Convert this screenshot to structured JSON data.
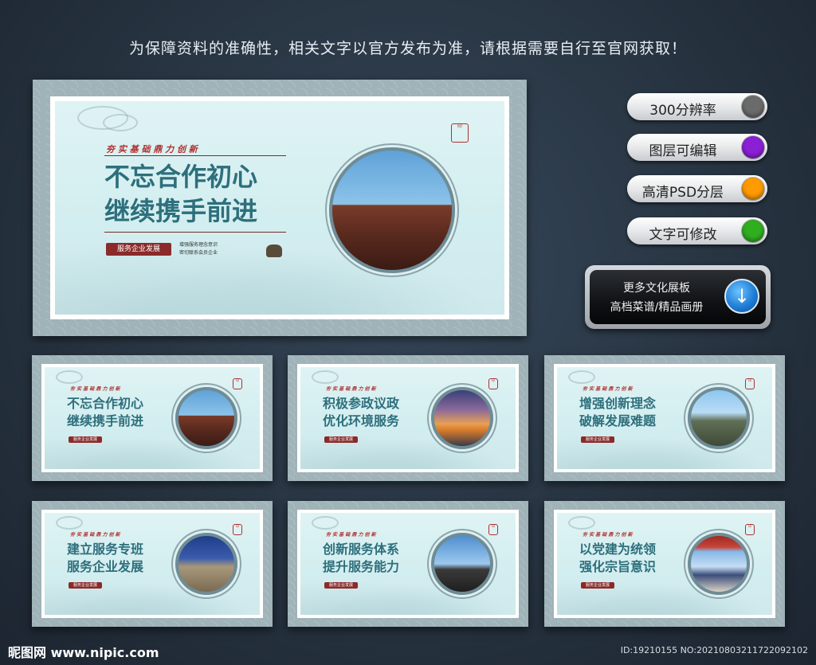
{
  "notice": "为保障资料的准确性，相关文字以官方发布为准，请根据需要自行至官网获取！",
  "main_board": {
    "subtitle": "夯 实 基 础   鼎 力 创 新",
    "title_line1": "不忘合作初心",
    "title_line2": "继续携手前进",
    "tag": "服务企业发展",
    "small_line1": "增强服务理念意识",
    "small_line2": "密切联系会员企业"
  },
  "features": [
    {
      "label": "300分辨率",
      "color": "#6b6b6b"
    },
    {
      "label": "图层可编辑",
      "color": "#8a1fd6"
    },
    {
      "label": "高清PSD分层",
      "color": "#ff9a00"
    },
    {
      "label": "文字可修改",
      "color": "#2fae1f"
    }
  ],
  "more_button": {
    "line1": "更多文化展板",
    "line2": "高档菜谱/精品画册",
    "icon": "download-arrow-icon"
  },
  "thumbnails": [
    {
      "subtitle": "夯 实 基 础   鼎 力 创 新",
      "line1": "不忘合作初心",
      "line2": "继续携手前进",
      "tag": "服务企业发展",
      "photo": "roof"
    },
    {
      "subtitle": "夯 实 基 础   鼎 力 创 新",
      "line1": "积极参政议政",
      "line2": "优化环境服务",
      "tag": "服务企业发展",
      "photo": "city"
    },
    {
      "subtitle": "夯 实 基 础   鼎 力 创 新",
      "line1": "增强创新理念",
      "line2": "破解发展难题",
      "tag": "服务企业发展",
      "photo": "mount"
    },
    {
      "subtitle": "夯 实 基 础   鼎 力 创 新",
      "line1": "建立服务专班",
      "line2": "服务企业发展",
      "tag": "服务企业发展",
      "photo": "sundial"
    },
    {
      "subtitle": "夯 实 基 础   鼎 力 创 新",
      "line1": "创新服务体系",
      "line2": "提升服务能力",
      "tag": "服务企业发展",
      "photo": "dragon"
    },
    {
      "subtitle": "夯 实 基 础   鼎 力 创 新",
      "line1": "以党建为统领",
      "line2": "强化宗旨意识",
      "tag": "服务企业发展",
      "photo": "temple"
    }
  ],
  "footer": {
    "logo": "昵图网 www.nipic.com",
    "id": "ID:19210155 NO:20210803211722092102"
  }
}
